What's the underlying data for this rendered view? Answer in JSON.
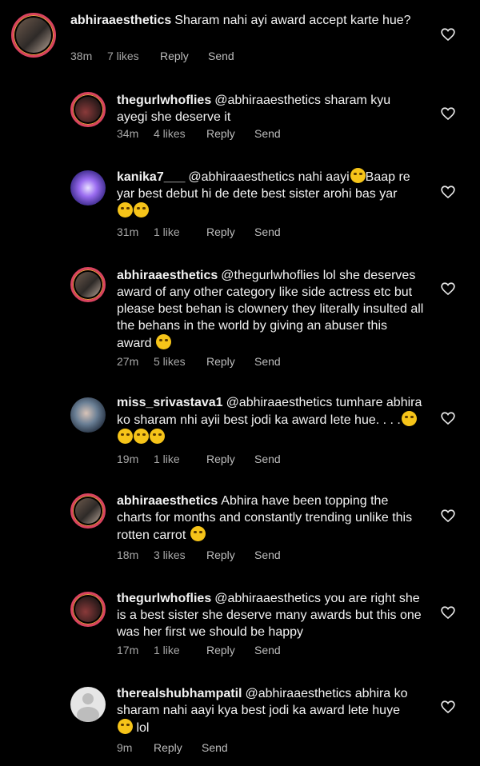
{
  "comments": [
    {
      "username": "abhiraaesthetics",
      "text": "Sharam nahi ayi award accept karte hue?",
      "time": "38m",
      "likes": "7 likes",
      "reply": "Reply",
      "send": "Send"
    },
    {
      "username": "thegurlwhoflies",
      "text": "@abhiraaesthetics sharam kyu ayegi she deserve it",
      "time": "34m",
      "likes": "4 likes",
      "reply": "Reply",
      "send": "Send"
    },
    {
      "username": "kanika7___",
      "text": "@abhiraaesthetics nahi aayi",
      "text2": "Baap re yar best debut hi de dete best sister arohi bas yar",
      "time": "31m",
      "likes": "1 like",
      "reply": "Reply",
      "send": "Send",
      "emojis": [
        "crying-emoji",
        "crying-emoji",
        "laughing-emoji"
      ]
    },
    {
      "username": "abhiraaesthetics",
      "text": "@thegurlwhoflies lol she deserves award of any other category like side actress etc but please best behan is clownery they literally insulted all the behans in the world by giving an abuser this award",
      "time": "27m",
      "likes": "5 likes",
      "reply": "Reply",
      "send": "Send",
      "emojis": [
        "disappointed-emoji"
      ]
    },
    {
      "username": "miss_srivastava1",
      "text": "@abhiraaesthetics tumhare abhira ko sharam nhi ayii best jodi ka award lete hue. . . .",
      "time": "19m",
      "likes": "1 like",
      "reply": "Reply",
      "send": "Send",
      "emojis": [
        "laughing-emoji",
        "laughing-emoji",
        "laughing-emoji",
        "laughing-emoji"
      ]
    },
    {
      "username": "abhiraaesthetics",
      "text": "Abhira have been topping the charts for months and constantly trending unlike this rotten carrot",
      "time": "18m",
      "likes": "3 likes",
      "reply": "Reply",
      "send": "Send",
      "emojis": [
        "hushed-emoji"
      ]
    },
    {
      "username": "thegurlwhoflies",
      "text": "@abhiraaesthetics you are right she is a best sister she deserve many awards  but this one was her first  we should be happy",
      "time": "17m",
      "likes": "1 like",
      "reply": "Reply",
      "send": "Send"
    },
    {
      "username": "therealshubhampatil",
      "text": "@abhiraaesthetics abhira ko sharam nahi aayi kya best jodi ka award lete huye",
      "text2": "lol",
      "time": "9m",
      "reply": "Reply",
      "send": "Send",
      "emojis": [
        "laughing-emoji"
      ]
    }
  ],
  "colors": {
    "background": "#000000",
    "text": "#f2f2f2",
    "meta": "#a8a8a8",
    "story_ring": "#d9435f"
  }
}
